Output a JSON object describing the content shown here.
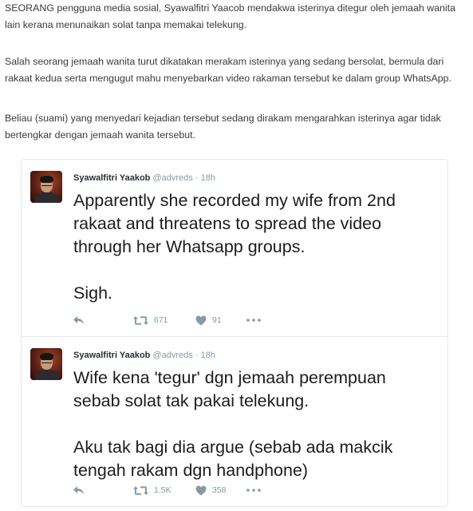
{
  "article": {
    "paragraphs": [
      [
        "SEORANG pengguna media sosial, Syawalfitri Yaacob mendakwa isterinya ditegur oleh jemaah wanita",
        "lain kerana menunaikan solat tanpa memakai telekung."
      ],
      [
        "Salah seorang jemaah wanita turut dikatakan merakam isterinya yang sedang bersolat, bermula dari",
        "rakaat kedua serta mengugut mahu menyebarkan video rakaman tersebut ke dalam group WhatsApp."
      ],
      [
        "Beliau (suami) yang menyedari kejadian tersebut sedang dirakam mengarahkan isterinya agar tidak",
        "bertengkar dengan jemaah wanita tersebut."
      ]
    ]
  },
  "tweets": [
    {
      "name": "Syawalfitri Yaakob",
      "handle": "@advreds",
      "separator": "·",
      "time": "18h",
      "lines": [
        "Apparently she recorded my wife from 2nd",
        "rakaat and threatens to spread the video",
        "through her Whatsapp groups.",
        "",
        "Sigh."
      ],
      "retweets": "671",
      "likes": "91"
    },
    {
      "name": "Syawalfitri Yaakob",
      "handle": "@advreds",
      "separator": "·",
      "time": "18h",
      "lines": [
        "Wife kena 'tegur' dgn jemaah perempuan",
        "sebab solat tak pakai telekung.",
        "",
        "Aku tak bagi dia argue (sebab ada makcik",
        "tengah rakam dgn handphone)"
      ],
      "retweets": "1.5K",
      "likes": "358"
    }
  ],
  "colors": {
    "icon": "#8899a6",
    "name": "#292f33",
    "text": "#1c1c1c",
    "border": "#e1e8ed"
  },
  "icons": {
    "reply": "reply-icon",
    "retweet": "retweet-icon",
    "like": "heart-icon",
    "more": "more-icon"
  }
}
